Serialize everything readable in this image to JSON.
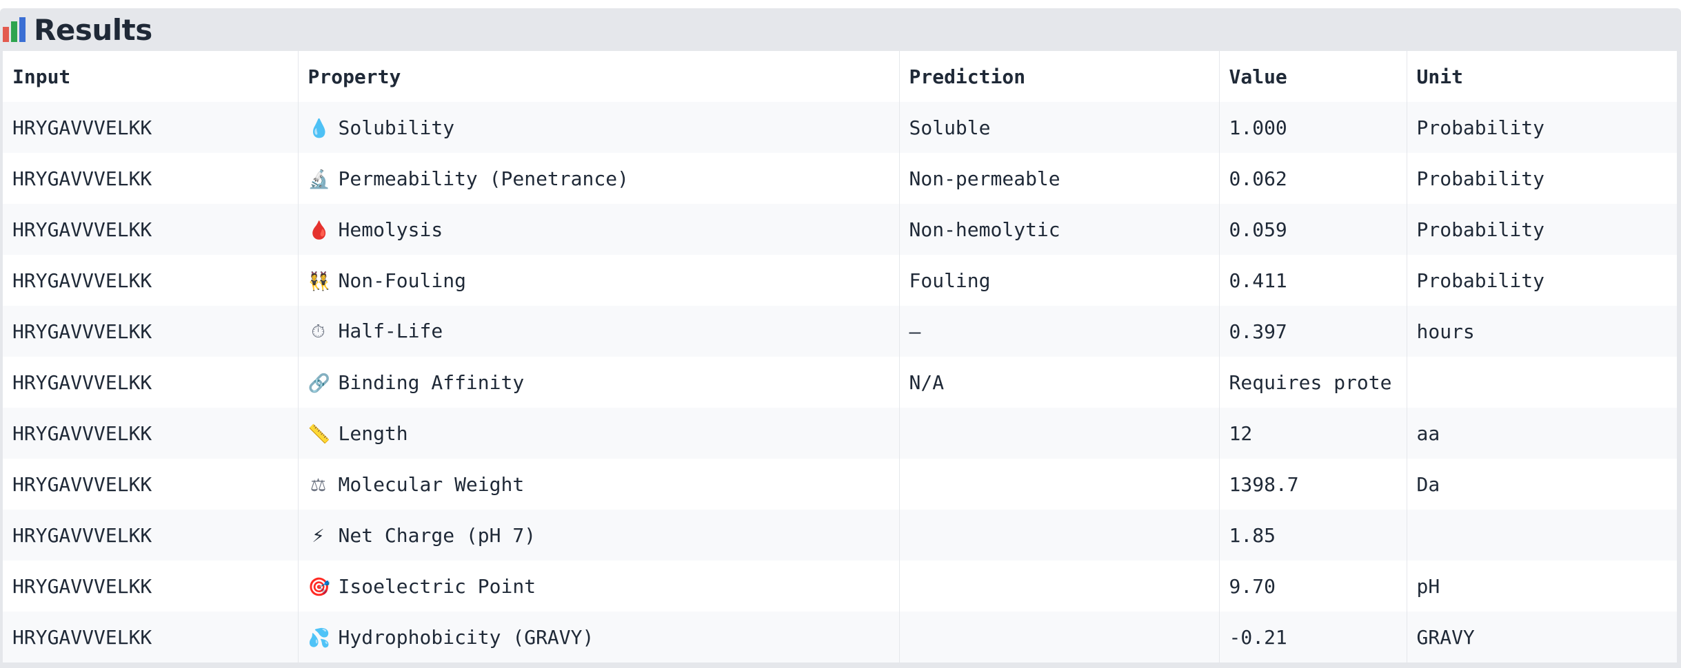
{
  "header": {
    "title": "Results",
    "icon": "bar-chart-icon",
    "icon_colors": [
      "#e35b4f",
      "#2ea44f",
      "#3b6fd4"
    ]
  },
  "table": {
    "columns": [
      "Input",
      "Property",
      "Prediction",
      "Value",
      "Unit"
    ],
    "rows": [
      {
        "input": "HRYGAVVVELKK",
        "icon": "droplet-icon",
        "icon_glyph": "💧",
        "icon_color": "#3b9de0",
        "property": "Solubility",
        "prediction": "Soluble",
        "value": "1.000",
        "unit": "Probability"
      },
      {
        "input": "HRYGAVVVELKK",
        "icon": "microscope-icon",
        "icon_glyph": "🔬",
        "icon_color": "#6b7280",
        "property": "Permeability (Penetrance)",
        "prediction": "Non-permeable",
        "value": "0.062",
        "unit": "Probability"
      },
      {
        "input": "HRYGAVVVELKK",
        "icon": "blood-drop-icon",
        "icon_glyph": "🩸",
        "icon_color": "#d0312d",
        "property": "Hemolysis",
        "prediction": "Non-hemolytic",
        "value": "0.059",
        "unit": "Probability"
      },
      {
        "input": "HRYGAVVVELKK",
        "icon": "people-icon",
        "icon_glyph": "👯",
        "icon_color": "#d4a017",
        "property": "Non-Fouling",
        "prediction": "Fouling",
        "value": "0.411",
        "unit": "Probability"
      },
      {
        "input": "HRYGAVVVELKK",
        "icon": "stopwatch-icon",
        "icon_glyph": "⏱",
        "icon_color": "#6b7280",
        "property": "Half-Life",
        "prediction": "—",
        "value": "0.397",
        "unit": "hours"
      },
      {
        "input": "HRYGAVVVELKK",
        "icon": "link-icon",
        "icon_glyph": "🔗",
        "icon_color": "#6b7280",
        "property": "Binding Affinity",
        "prediction": "N/A",
        "value": "Requires prote",
        "unit": ""
      },
      {
        "input": "HRYGAVVVELKK",
        "icon": "ruler-icon",
        "icon_glyph": "📏",
        "icon_color": "#8a8fa0",
        "property": "Length",
        "prediction": "",
        "value": "12",
        "unit": "aa"
      },
      {
        "input": "HRYGAVVVELKK",
        "icon": "scale-icon",
        "icon_glyph": "⚖",
        "icon_color": "#6b7280",
        "property": "Molecular Weight",
        "prediction": "",
        "value": "1398.7",
        "unit": "Da"
      },
      {
        "input": "HRYGAVVVELKK",
        "icon": "lightning-icon",
        "icon_glyph": "⚡",
        "icon_color": "#1f2937",
        "property": "Net Charge (pH 7)",
        "prediction": "",
        "value": "1.85",
        "unit": ""
      },
      {
        "input": "HRYGAVVVELKK",
        "icon": "target-icon",
        "icon_glyph": "🎯",
        "icon_color": "#d0312d",
        "property": "Isoelectric Point",
        "prediction": "",
        "value": "9.70",
        "unit": "pH"
      },
      {
        "input": "HRYGAVVVELKK",
        "icon": "water-splash-icon",
        "icon_glyph": "💦",
        "icon_color": "#3b9de0",
        "property": "Hydrophobicity (GRAVY)",
        "prediction": "",
        "value": "-0.21",
        "unit": "GRAVY"
      }
    ]
  }
}
